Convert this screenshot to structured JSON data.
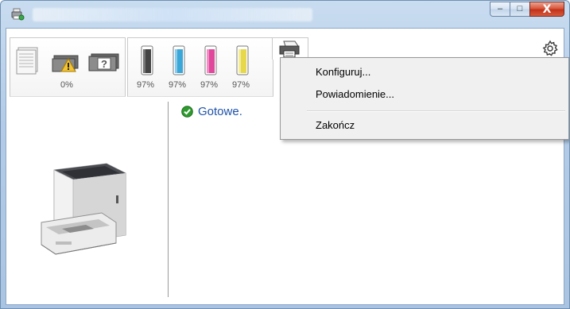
{
  "window": {
    "title": "",
    "buttons": {
      "minimize": "–",
      "maximize": "□",
      "close": "X"
    }
  },
  "toolbar": {
    "groups": [
      {
        "items": [
          {
            "icon": "paper-stack-icon",
            "percent": ""
          },
          {
            "icon": "toner-warning-icon",
            "percent": "0%"
          },
          {
            "icon": "question-box-icon",
            "percent": ""
          }
        ]
      },
      {
        "items": [
          {
            "icon": "toner-black-icon",
            "percent": "97%"
          },
          {
            "icon": "toner-cyan-icon",
            "percent": "97%"
          },
          {
            "icon": "toner-magenta-icon",
            "percent": "97%"
          },
          {
            "icon": "toner-yellow-icon",
            "percent": "97%"
          }
        ]
      },
      {
        "items": [
          {
            "icon": "printer-tray-icon",
            "percent": ""
          }
        ]
      }
    ],
    "settings_icon": "gear-icon"
  },
  "colors": {
    "status_text": "#1f52a8",
    "check_green": "#2e9b2e",
    "toner_black": "#444444",
    "toner_cyan": "#3aa7d8",
    "toner_magenta": "#e0489c",
    "toner_yellow": "#e6d84a"
  },
  "status": {
    "text": "Gotowe.",
    "icon": "check-circle-icon"
  },
  "context_menu": {
    "items": [
      {
        "label": "Konfiguruj..."
      },
      {
        "label": "Powiadomienie..."
      },
      {
        "label": "Zakończ"
      }
    ]
  }
}
